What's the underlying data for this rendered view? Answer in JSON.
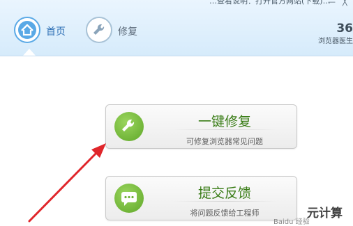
{
  "top_hint": "…查看说明：打开官方网站(下载)…",
  "window_controls": {
    "minimize": "—",
    "close": "╳"
  },
  "nav": {
    "items": [
      {
        "label": "首页",
        "icon": "home-icon",
        "active": true
      },
      {
        "label": "修复",
        "icon": "wrench-icon",
        "active": false
      }
    ]
  },
  "brand": {
    "number": "36",
    "subtitle": "浏览器医生"
  },
  "buttons": {
    "repair": {
      "title": "一键修复",
      "subtitle": "可修复浏览器常见问题",
      "icon": "wrench-icon"
    },
    "feedback": {
      "title": "提交反馈",
      "subtitle": "将问题反馈给工程师",
      "icon": "chat-icon"
    }
  },
  "watermark": {
    "text": "元计算",
    "subtext": "Baidu 经验"
  },
  "colors": {
    "accent": "#5aa9e6",
    "green": "#3a7d17",
    "arrow": "#e0262b"
  }
}
